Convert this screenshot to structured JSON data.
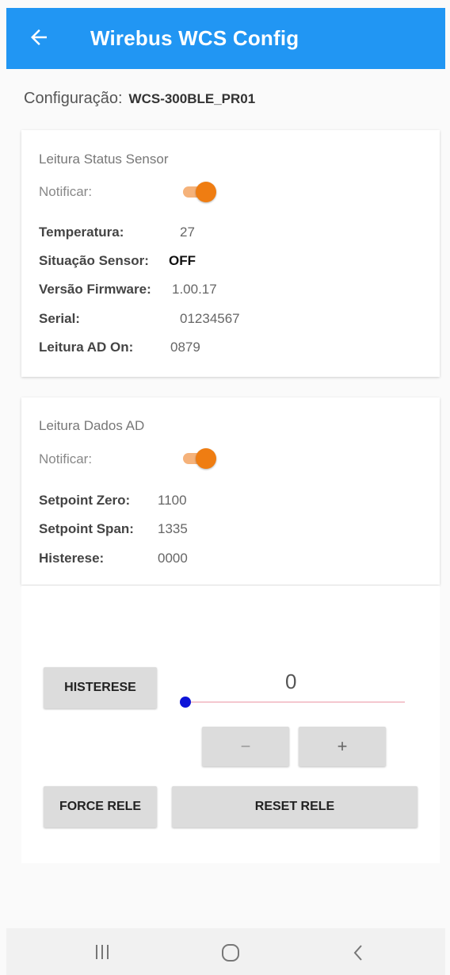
{
  "header": {
    "title": "Wirebus WCS Config",
    "back_icon": "arrow-left-icon"
  },
  "config": {
    "label": "Configuração:",
    "value": "WCS-300BLE_PR01"
  },
  "status_card": {
    "title": "Leitura Status Sensor",
    "notify_label": "Notificar:",
    "notify_on": true,
    "fields": [
      {
        "label": "Temperatura:",
        "value": "27"
      },
      {
        "label": "Situação Sensor:",
        "value": "OFF"
      },
      {
        "label": "Versão Firmware:",
        "value": "1.00.17"
      },
      {
        "label": "Serial:",
        "value": "01234567"
      },
      {
        "label": "Leitura AD On:",
        "value": "0879"
      }
    ]
  },
  "ad_card": {
    "title": "Leitura Dados AD",
    "notify_label": "Notificar:",
    "notify_on": true,
    "fields": [
      {
        "label": "Setpoint Zero:",
        "value": "1100"
      },
      {
        "label": "Setpoint Span:",
        "value": "1335"
      },
      {
        "label": "Histerese:",
        "value": "0000"
      }
    ]
  },
  "controls": {
    "histerese_button": "HISTERESE",
    "slider_value": "0",
    "slider_fraction": 0,
    "minus_label": "−",
    "plus_label": "+",
    "force_rele": "FORCE RELE",
    "reset_rele": "RESET RELE"
  },
  "navbar": {
    "recent_icon": "recent-apps-icon",
    "home_icon": "home-icon",
    "back_icon": "back-chevron-icon"
  },
  "colors": {
    "app_bar": "#2196f3",
    "toggle_on": "#ef7d12",
    "slider_thumb": "#0d14d8"
  }
}
